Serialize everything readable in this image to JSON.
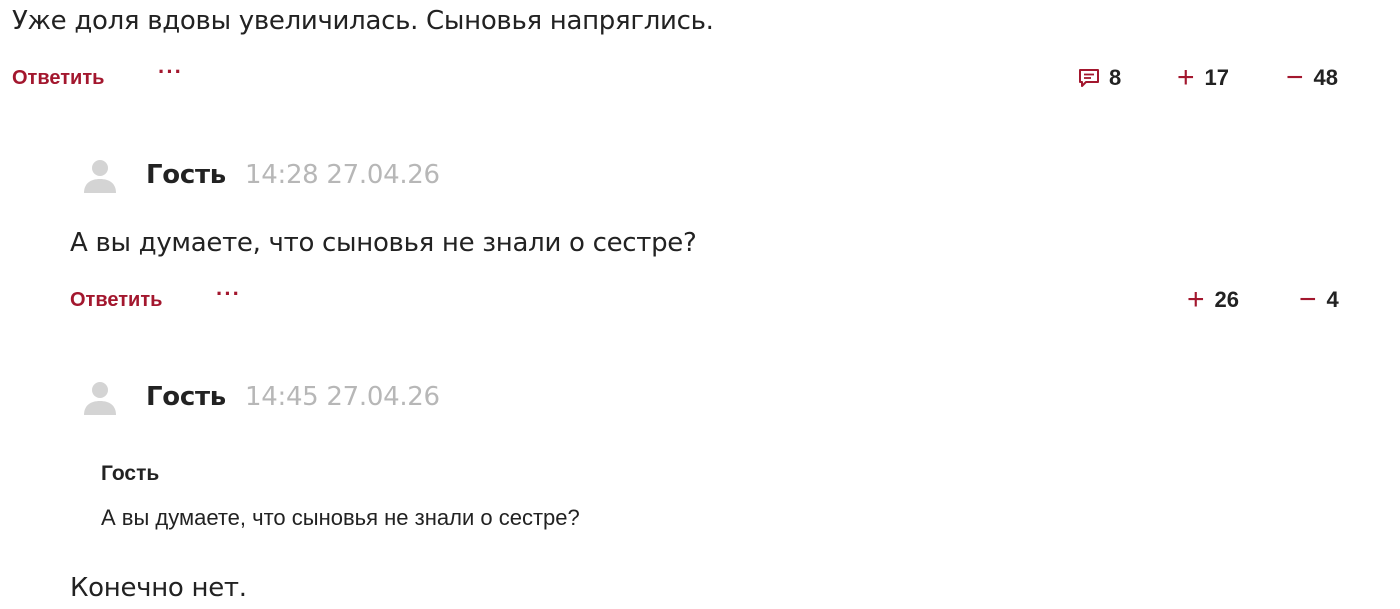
{
  "colors": {
    "accent": "#a3172e",
    "text": "#222222",
    "timestamp": "#b7b7b7",
    "avatar": "#d4d4d4"
  },
  "icons": {
    "avatar": "user-silhouette-icon",
    "replies": "comment-icon",
    "more": "more-dots-icon"
  },
  "comment_top": {
    "text": "Уже доля вдовы увеличилась. Сыновья напряглись.",
    "reply_label": "Ответить",
    "more_label": "···",
    "replies_count": "8",
    "plus_sign": "+",
    "plus_count": "17",
    "minus_sign": "−",
    "minus_count": "48"
  },
  "comment_1": {
    "author": "Гость",
    "timestamp": "14:28 27.04.26",
    "text": "А вы думаете, что сыновья не знали о сестре?",
    "reply_label": "Ответить",
    "more_label": "···",
    "plus_sign": "+",
    "plus_count": "26",
    "minus_sign": "−",
    "minus_count": "4"
  },
  "comment_2": {
    "author": "Гость",
    "timestamp": "14:45 27.04.26",
    "quote_author": "Гость",
    "quote_text": "А вы думаете, что сыновья не знали о сестре?",
    "text": "Конечно нет."
  }
}
